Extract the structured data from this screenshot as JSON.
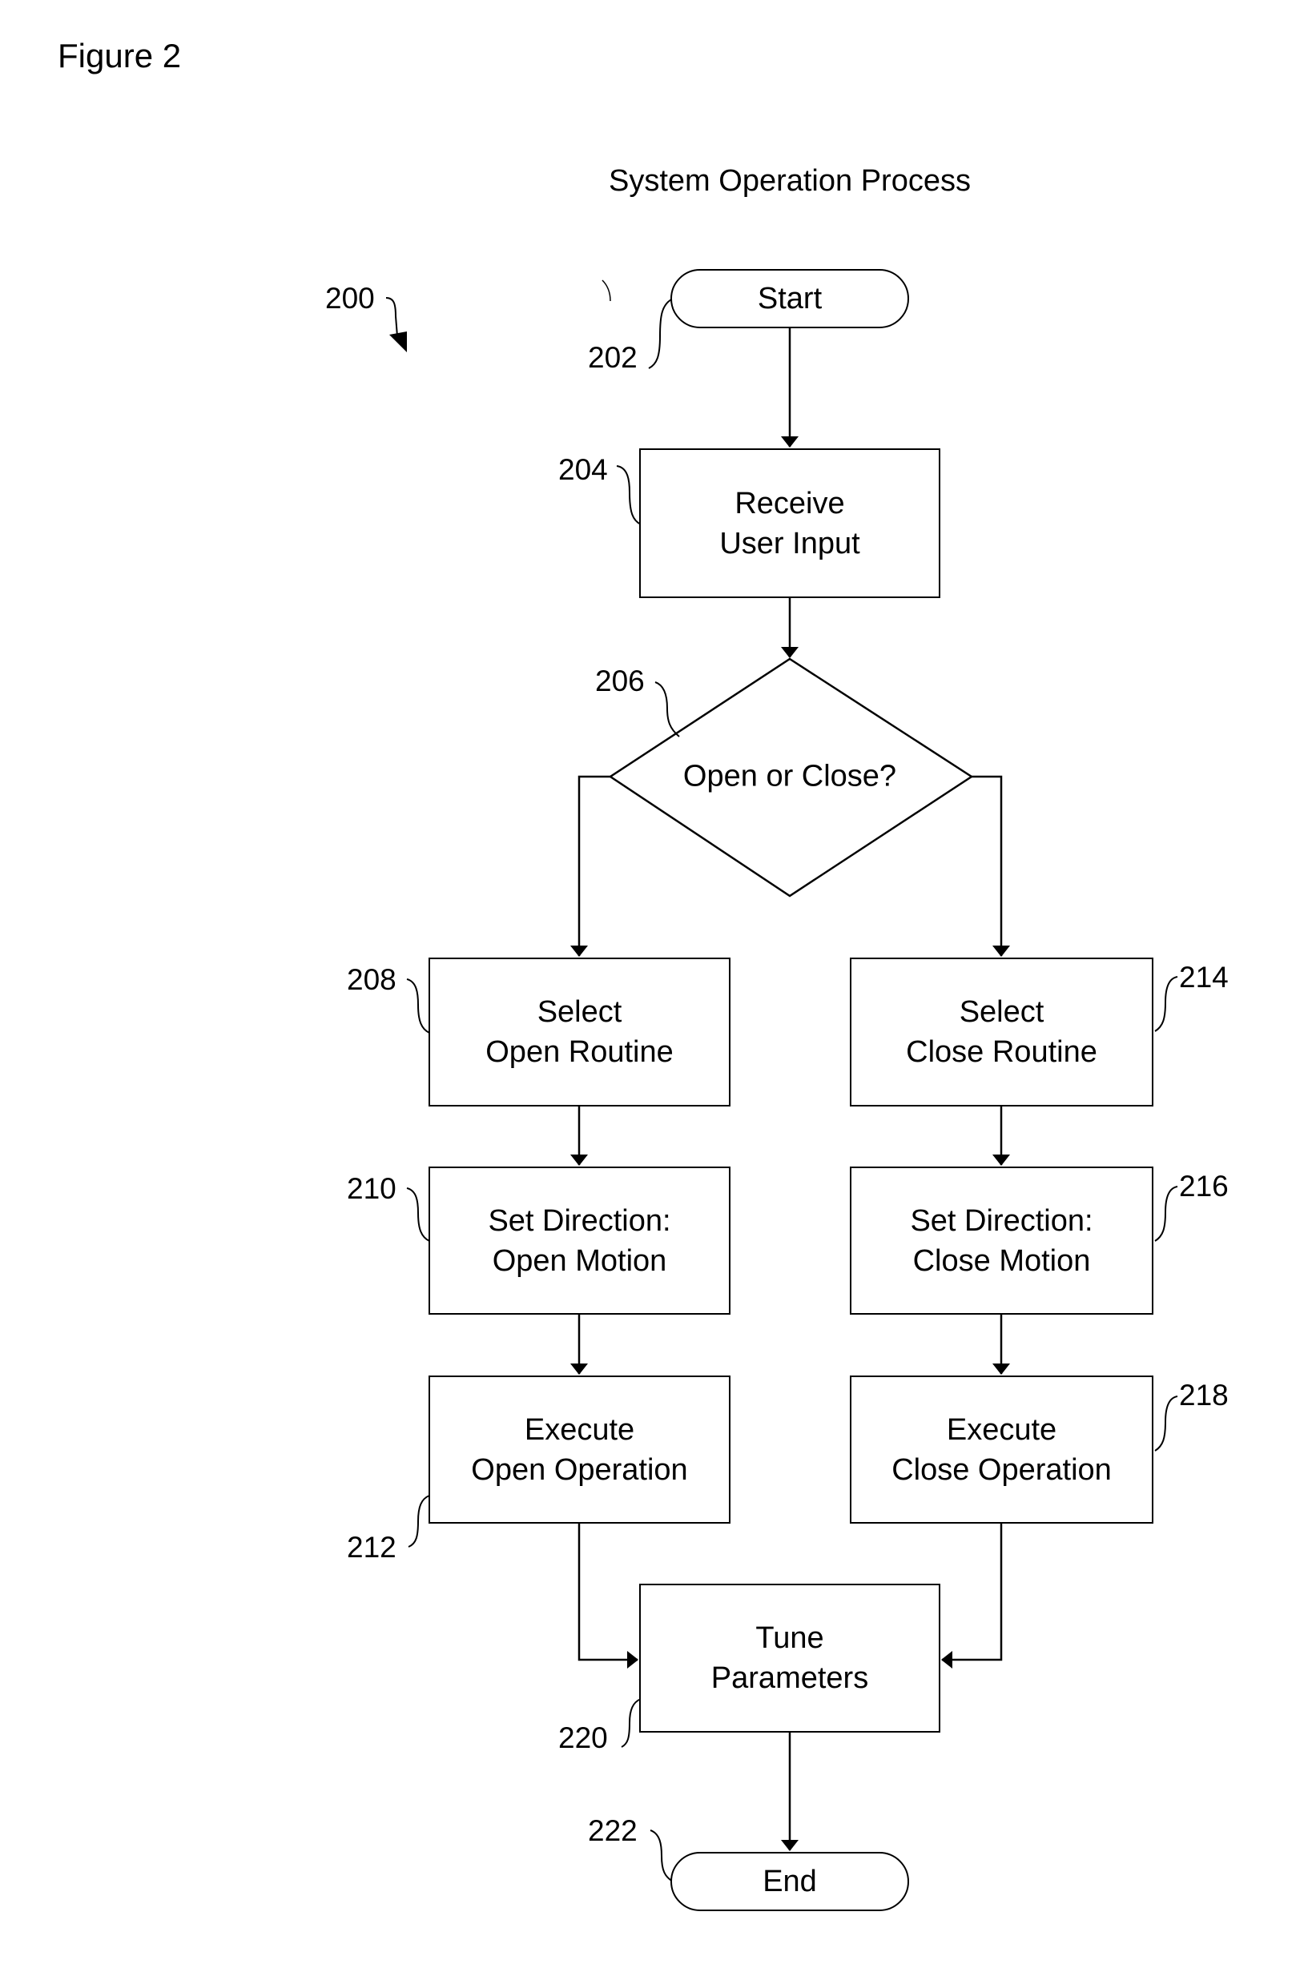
{
  "figure_label": "Figure 2",
  "title": "System Operation Process",
  "process_ref": "200",
  "nodes": {
    "start": {
      "ref": "202",
      "label": "Start",
      "shape": "terminator"
    },
    "receive_input": {
      "ref": "204",
      "line1": "Receive",
      "line2": "User Input",
      "shape": "process"
    },
    "decision": {
      "ref": "206",
      "label": "Open or Close?",
      "shape": "decision"
    },
    "select_open": {
      "ref": "208",
      "line1": "Select",
      "line2": "Open Routine",
      "shape": "process"
    },
    "set_open": {
      "ref": "210",
      "line1": "Set Direction:",
      "line2": "Open Motion",
      "shape": "process"
    },
    "exec_open": {
      "ref": "212",
      "line1": "Execute",
      "line2": "Open Operation",
      "shape": "process"
    },
    "select_close": {
      "ref": "214",
      "line1": "Select",
      "line2": "Close Routine",
      "shape": "process"
    },
    "set_close": {
      "ref": "216",
      "line1": "Set Direction:",
      "line2": "Close Motion",
      "shape": "process"
    },
    "exec_close": {
      "ref": "218",
      "line1": "Execute",
      "line2": "Close Operation",
      "shape": "process"
    },
    "tune": {
      "ref": "220",
      "line1": "Tune",
      "line2": "Parameters",
      "shape": "process"
    },
    "end": {
      "ref": "222",
      "label": "End",
      "shape": "terminator"
    }
  },
  "edges": [
    {
      "from": "start",
      "to": "receive_input"
    },
    {
      "from": "receive_input",
      "to": "decision"
    },
    {
      "from": "decision",
      "to": "select_open"
    },
    {
      "from": "decision",
      "to": "select_close"
    },
    {
      "from": "select_open",
      "to": "set_open"
    },
    {
      "from": "set_open",
      "to": "exec_open"
    },
    {
      "from": "select_close",
      "to": "set_close"
    },
    {
      "from": "set_close",
      "to": "exec_close"
    },
    {
      "from": "exec_open",
      "to": "tune"
    },
    {
      "from": "exec_close",
      "to": "tune"
    },
    {
      "from": "tune",
      "to": "end"
    }
  ]
}
